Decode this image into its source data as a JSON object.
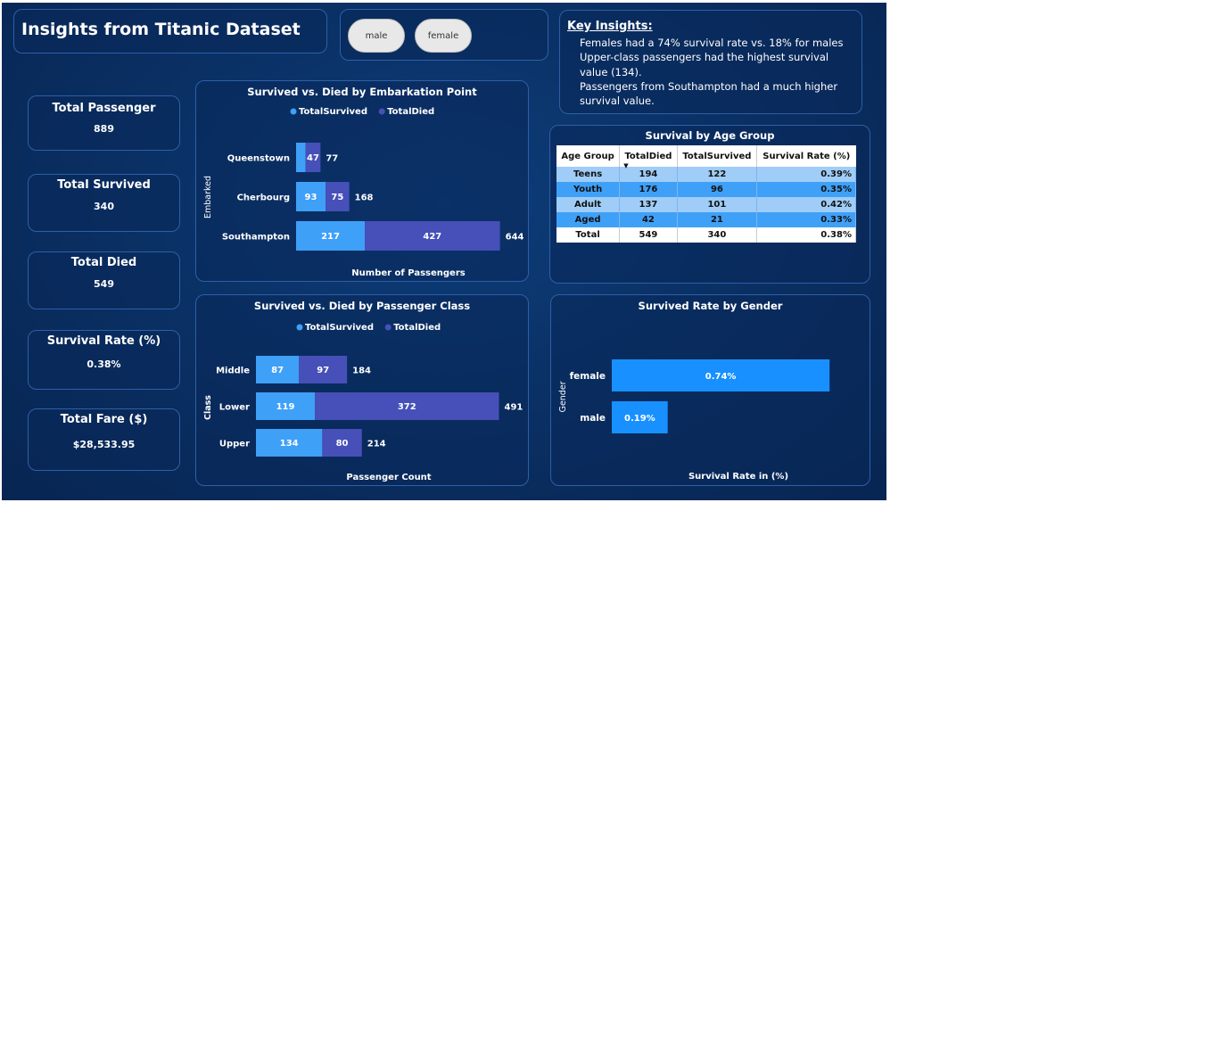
{
  "header": {
    "title": "Insights from Titanic Dataset"
  },
  "slicer": {
    "options": [
      "male",
      "female"
    ]
  },
  "insights": {
    "heading": "Key Insights:",
    "lines": [
      "Females had a 74% survival rate vs. 18% for males",
      "Upper-class passengers had the highest survival value (134).",
      "Passengers from Southampton had a much higher survival value."
    ]
  },
  "kpis": [
    {
      "label": "Total Passenger",
      "value": "889"
    },
    {
      "label": "Total Survived",
      "value": "340"
    },
    {
      "label": "Total Died",
      "value": "549"
    },
    {
      "label": "Survival Rate (%)",
      "value": "0.38%"
    },
    {
      "label": "Total Fare ($)",
      "value": "$28,533.95"
    }
  ],
  "colors": {
    "survived": "#3fa0f8",
    "died": "#4650b8",
    "gender_bar": "#1890ff"
  },
  "age_table": {
    "title": "Survival by Age Group",
    "headers": [
      "Age Group",
      "TotalDied",
      "TotalSurvived",
      "Survival Rate (%)"
    ],
    "rows": [
      [
        "Teens",
        "194",
        "122",
        "0.39%"
      ],
      [
        "Youth",
        "176",
        "96",
        "0.35%"
      ],
      [
        "Adult",
        "137",
        "101",
        "0.42%"
      ],
      [
        "Aged",
        "42",
        "21",
        "0.33%"
      ]
    ],
    "total": [
      "Total",
      "549",
      "340",
      "0.38%"
    ]
  },
  "chart_data": [
    {
      "type": "bar",
      "orientation": "horizontal-stacked",
      "title": "Survived vs. Died by Embarkation Point",
      "xlabel": "Number of Passengers",
      "ylabel": "Embarked",
      "legend": "top-center",
      "categories": [
        "Queenstown",
        "Cherbourg",
        "Southampton"
      ],
      "series": [
        {
          "name": "TotalSurvived",
          "values": [
            30,
            93,
            217
          ],
          "labels": [
            "",
            "93",
            "217"
          ]
        },
        {
          "name": "TotalDied",
          "values": [
            47,
            75,
            427
          ],
          "labels": [
            "47",
            "75",
            "427"
          ]
        }
      ],
      "totals": [
        77,
        168,
        644
      ]
    },
    {
      "type": "bar",
      "orientation": "horizontal-stacked",
      "title": "Survived vs. Died by Passenger Class",
      "xlabel": "Passenger Count",
      "ylabel": "Class",
      "legend": "top-center",
      "categories": [
        "Middle",
        "Lower",
        "Upper"
      ],
      "series": [
        {
          "name": "TotalSurvived",
          "values": [
            87,
            119,
            134
          ],
          "labels": [
            "87",
            "119",
            "134"
          ]
        },
        {
          "name": "TotalDied",
          "values": [
            97,
            372,
            80
          ],
          "labels": [
            "97",
            "372",
            "80"
          ]
        }
      ],
      "totals": [
        184,
        491,
        214
      ]
    },
    {
      "type": "bar",
      "orientation": "horizontal",
      "title": "Survived Rate by Gender",
      "xlabel": "Survival Rate in (%)",
      "ylabel": "Gender",
      "categories": [
        "female",
        "male"
      ],
      "values": [
        0.74,
        0.19
      ],
      "labels": [
        "0.74%",
        "0.19%"
      ]
    }
  ]
}
